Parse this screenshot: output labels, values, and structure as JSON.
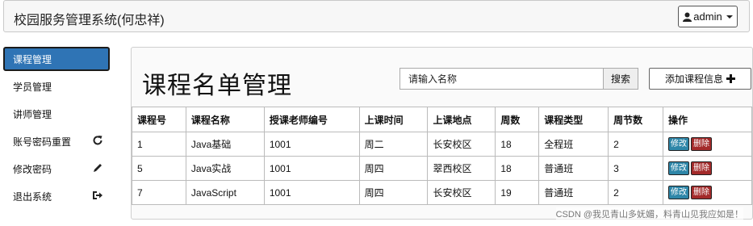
{
  "header": {
    "brand": "校园服务管理系统(何忠祥)",
    "user_label": "admin"
  },
  "sidebar": {
    "items": [
      {
        "label": "课程管理",
        "icon": ""
      },
      {
        "label": "学员管理",
        "icon": ""
      },
      {
        "label": "讲师管理",
        "icon": ""
      },
      {
        "label": "账号密码重置",
        "icon": "refresh-icon"
      },
      {
        "label": "修改密码",
        "icon": "pencil-icon"
      },
      {
        "label": "退出系统",
        "icon": "logout-icon"
      }
    ]
  },
  "main": {
    "title": "课程名单管理",
    "search": {
      "placeholder": "请输入名称",
      "button": "搜索"
    },
    "add_button": "添加课程信息",
    "columns": [
      "课程号",
      "课程名称",
      "授课老师编号",
      "上课时间",
      "上课地点",
      "周数",
      "课程类型",
      "周节数",
      "操作"
    ],
    "rows": [
      [
        "1",
        "Java基础",
        "1001",
        "周二",
        "长安校区",
        "18",
        "全程班",
        "2"
      ],
      [
        "5",
        "Java实战",
        "1001",
        "周四",
        "翠西校区",
        "18",
        "普通班",
        "3"
      ],
      [
        "7",
        "JavaScript",
        "1001",
        "周四",
        "长安校区",
        "19",
        "普通班",
        "2"
      ]
    ],
    "edit_label": "修改",
    "delete_label": "删除"
  },
  "watermark": "CSDN @我见青山多妩媚，料青山见我应如是！",
  "colors": {
    "accent": "#2f74b5",
    "edit": "#2e86a8",
    "delete": "#a32a2a"
  }
}
